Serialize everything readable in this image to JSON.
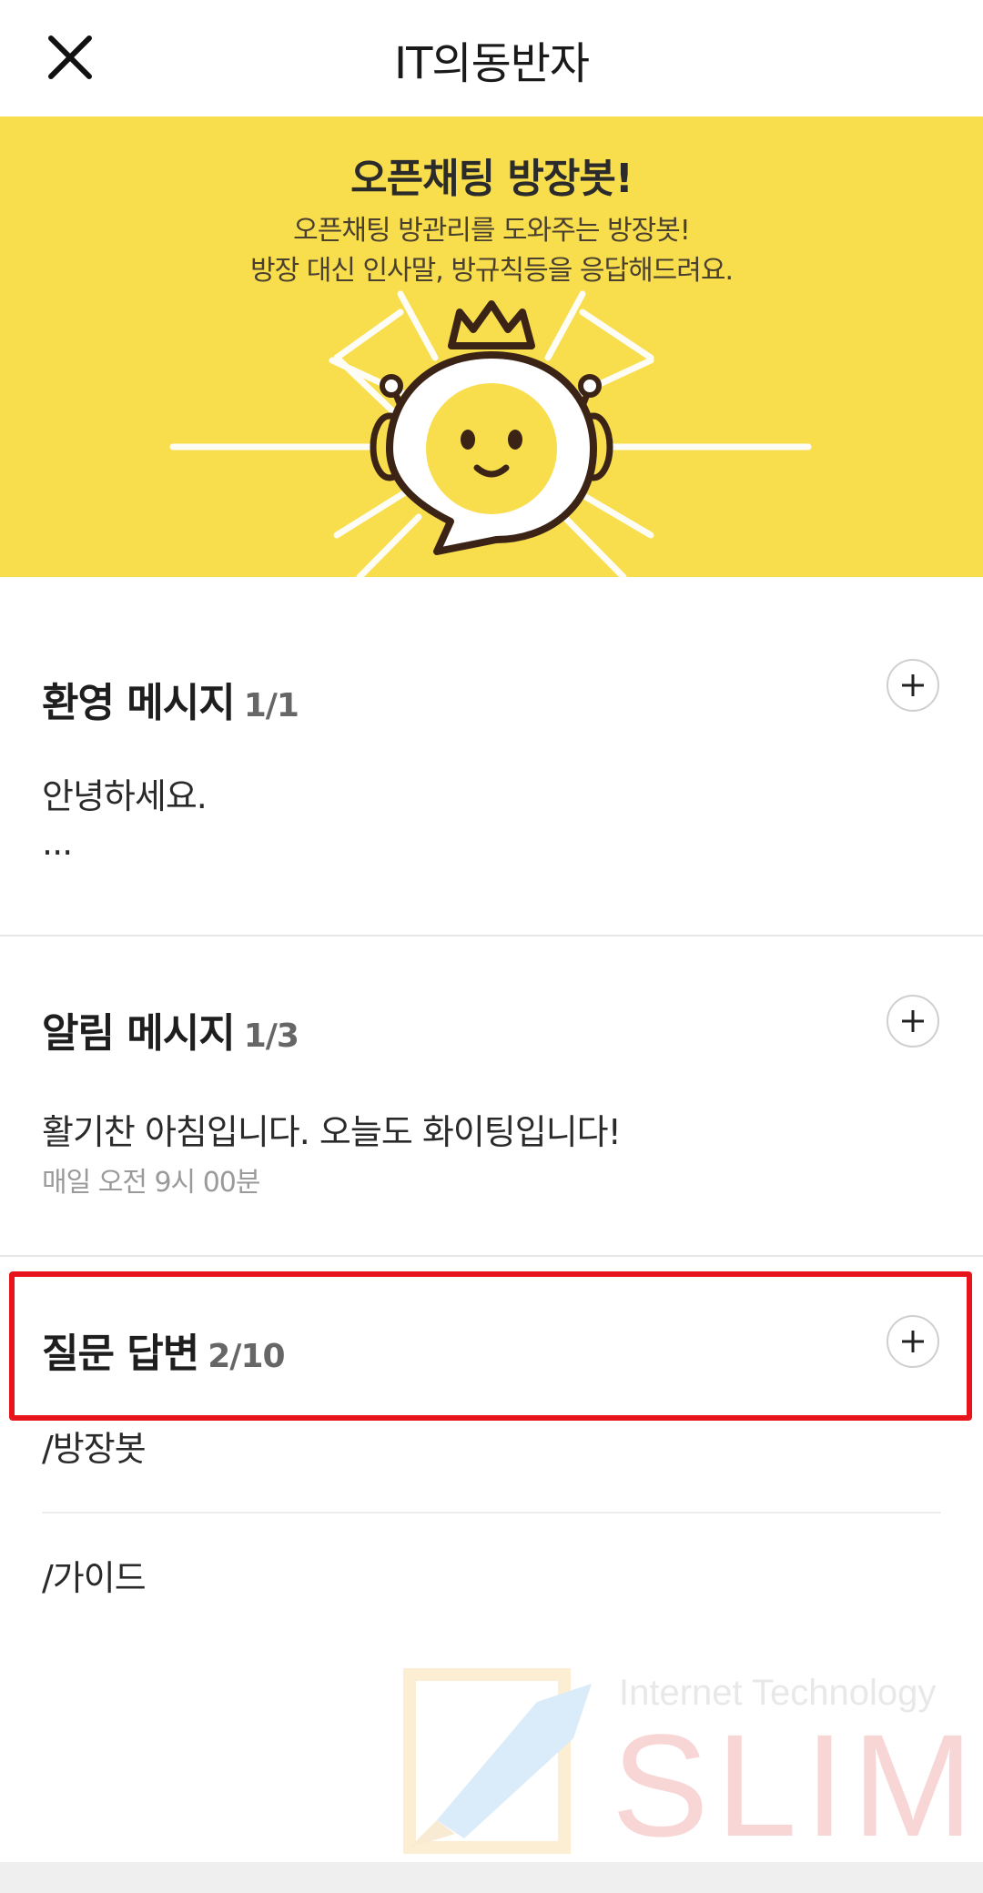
{
  "header": {
    "title": "IT의동반자",
    "close_icon": "close-icon"
  },
  "banner": {
    "title": "오픈채팅 방장봇!",
    "desc_line1": "오픈채팅 방관리를 도와주는 방장봇!",
    "desc_line2": "방장 대신 인사말, 방규칙등을 응답해드려요.",
    "background_color": "#f8dd4d",
    "mascot_icon": "crowned-bot-mascot"
  },
  "welcome": {
    "title": "환영 메시지",
    "count": "1/1",
    "line1": "안녕하세요.",
    "line2": "..."
  },
  "notice": {
    "title": "알림 메시지",
    "count": "1/3",
    "message": "활기찬 아침입니다. 오늘도 화이팅입니다!",
    "schedule": "매일 오전 9시 00분"
  },
  "qa": {
    "title": "질문 답변",
    "count": "2/10",
    "items": [
      "/방장봇",
      "/가이드"
    ],
    "highlight_color": "#e8141b"
  },
  "watermark": {
    "top": "Internet Technology",
    "brand": "SLIM"
  }
}
